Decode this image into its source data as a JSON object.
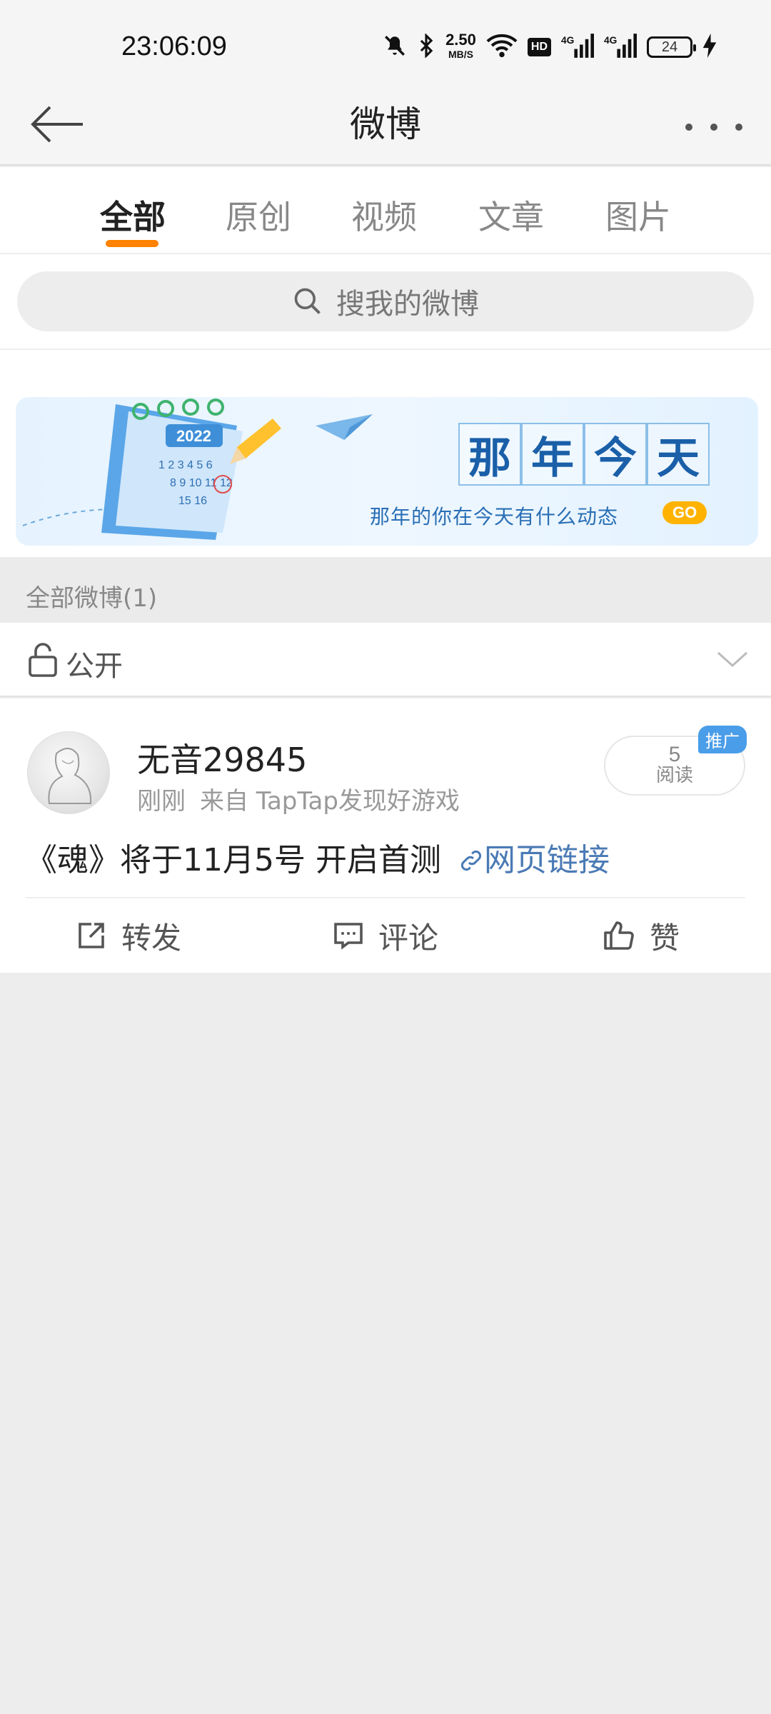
{
  "status_bar": {
    "time": "23:06:09",
    "net_speed": "2.50",
    "net_unit": "MB/S",
    "hd": "HD",
    "signal1": "4G",
    "signal2": "4G",
    "battery": "24"
  },
  "header": {
    "title": "微博"
  },
  "tabs": [
    {
      "label": "全部",
      "active": true
    },
    {
      "label": "原创"
    },
    {
      "label": "视频"
    },
    {
      "label": "文章"
    },
    {
      "label": "图片"
    }
  ],
  "search": {
    "placeholder": "搜我的微博"
  },
  "banner": {
    "calendar_year": "2022",
    "title_chars": [
      "那",
      "年",
      "今",
      "天"
    ],
    "subtitle": "那年的你在今天有什么动态",
    "go_label": "GO"
  },
  "section": {
    "label": "全部微博(1)"
  },
  "filter": {
    "label": "公开"
  },
  "post": {
    "username": "无音29845",
    "time": "刚刚",
    "source": "来自 TapTap发现好游戏",
    "read_count": "5",
    "read_label": "阅读",
    "promo_badge": "推广",
    "text": "《魂》将于11月5号 开启首测",
    "link_text": "网页链接",
    "actions": {
      "repost": "转发",
      "comment": "评论",
      "like": "赞"
    }
  },
  "colors": {
    "accent": "#ff8200",
    "link": "#4a7ab5",
    "banner_text": "#1a5fa8",
    "go_button": "#ffb300",
    "promo_badge": "#4a9de8"
  }
}
